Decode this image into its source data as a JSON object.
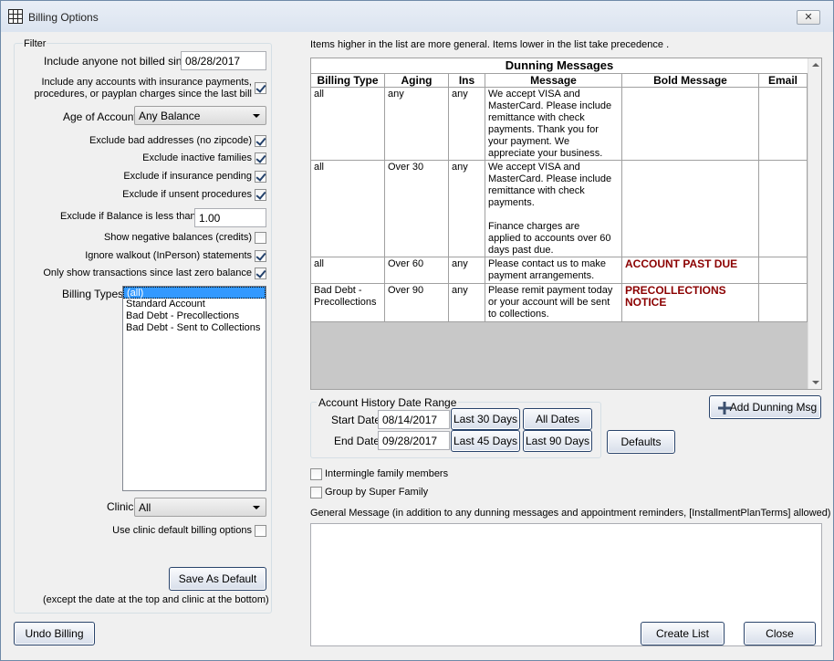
{
  "window": {
    "title": "Billing Options",
    "close_label": "✕"
  },
  "filter": {
    "legend": "Filter",
    "not_billed_since_label": "Include anyone not billed since",
    "not_billed_since_value": "08/28/2017",
    "include_ins_label_1": "Include any accounts with insurance payments,",
    "include_ins_label_2": "procedures, or payplan charges since the last bill",
    "age_label": "Age of Account",
    "age_value": "Any Balance",
    "exclude_bad_addresses": "Exclude bad addresses (no zipcode)",
    "exclude_inactive": "Exclude inactive families",
    "exclude_ins_pending": "Exclude if insurance pending",
    "exclude_unsent": "Exclude if unsent procedures",
    "exclude_balance_label": "Exclude if Balance is less than",
    "exclude_balance_value": "1.00",
    "show_negative": "Show negative balances (credits)",
    "ignore_walkout": "Ignore walkout (InPerson) statements",
    "only_show_since_zero": "Only show transactions since last zero balance",
    "billing_types_label": "Billing Types",
    "billing_types": [
      "(all)",
      "Standard Account",
      "Bad Debt - Precollections",
      "Bad Debt - Sent to Collections"
    ],
    "clinic_label": "Clinic",
    "clinic_value": "All",
    "use_clinic_default": "Use clinic default billing options",
    "save_default_label": "Save As Default",
    "save_default_note": "(except the date at the top and clinic at the bottom)"
  },
  "dunning": {
    "hint": "Items higher in the list are more general.  Items lower in the list take precedence .",
    "title": "Dunning Messages",
    "columns": [
      "Billing Type",
      "Aging",
      "Ins",
      "Message",
      "Bold Message",
      "Email"
    ],
    "rows": [
      {
        "billing_type": "all",
        "aging": "any",
        "ins": "any",
        "message": "We accept VISA and\nMasterCard. Please include\nremittance with check\npayments. Thank you for\nyour payment. We\nappreciate your business.",
        "bold": "",
        "email": ""
      },
      {
        "billing_type": "all",
        "aging": "Over 30",
        "ins": "any",
        "message": "We accept VISA and\nMasterCard. Please include\nremittance with check\npayments.\n\nFinance charges are\napplied to accounts over 60\ndays past due.",
        "bold": "",
        "email": ""
      },
      {
        "billing_type": "all",
        "aging": "Over 60",
        "ins": "any",
        "message": "Please contact us to make\npayment arrangements.",
        "bold": "ACCOUNT PAST DUE",
        "email": ""
      },
      {
        "billing_type": "Bad Debt -\nPrecollections",
        "aging": "Over 90",
        "ins": "any",
        "message": "Please remit payment today\nor your account will be sent\nto collections.",
        "bold": "PRECOLLECTIONS\nNOTICE",
        "email": ""
      }
    ],
    "add_label": "Add Dunning Msg"
  },
  "date_range": {
    "legend": "Account History Date Range",
    "start_label": "Start Date",
    "start_value": "08/14/2017",
    "end_label": "End Date",
    "end_value": "09/28/2017",
    "last30": "Last 30 Days",
    "all_dates": "All Dates",
    "last45": "Last 45 Days",
    "last90": "Last 90 Days",
    "defaults": "Defaults"
  },
  "options": {
    "intermingle": "Intermingle family members",
    "super_family": "Group by Super Family"
  },
  "general_message_label": "General Message (in addition to any dunning messages and appointment reminders, [InstallmentPlanTerms] allowed)",
  "general_message_value": "",
  "footer": {
    "undo": "Undo Billing",
    "create": "Create List",
    "close": "Close"
  }
}
